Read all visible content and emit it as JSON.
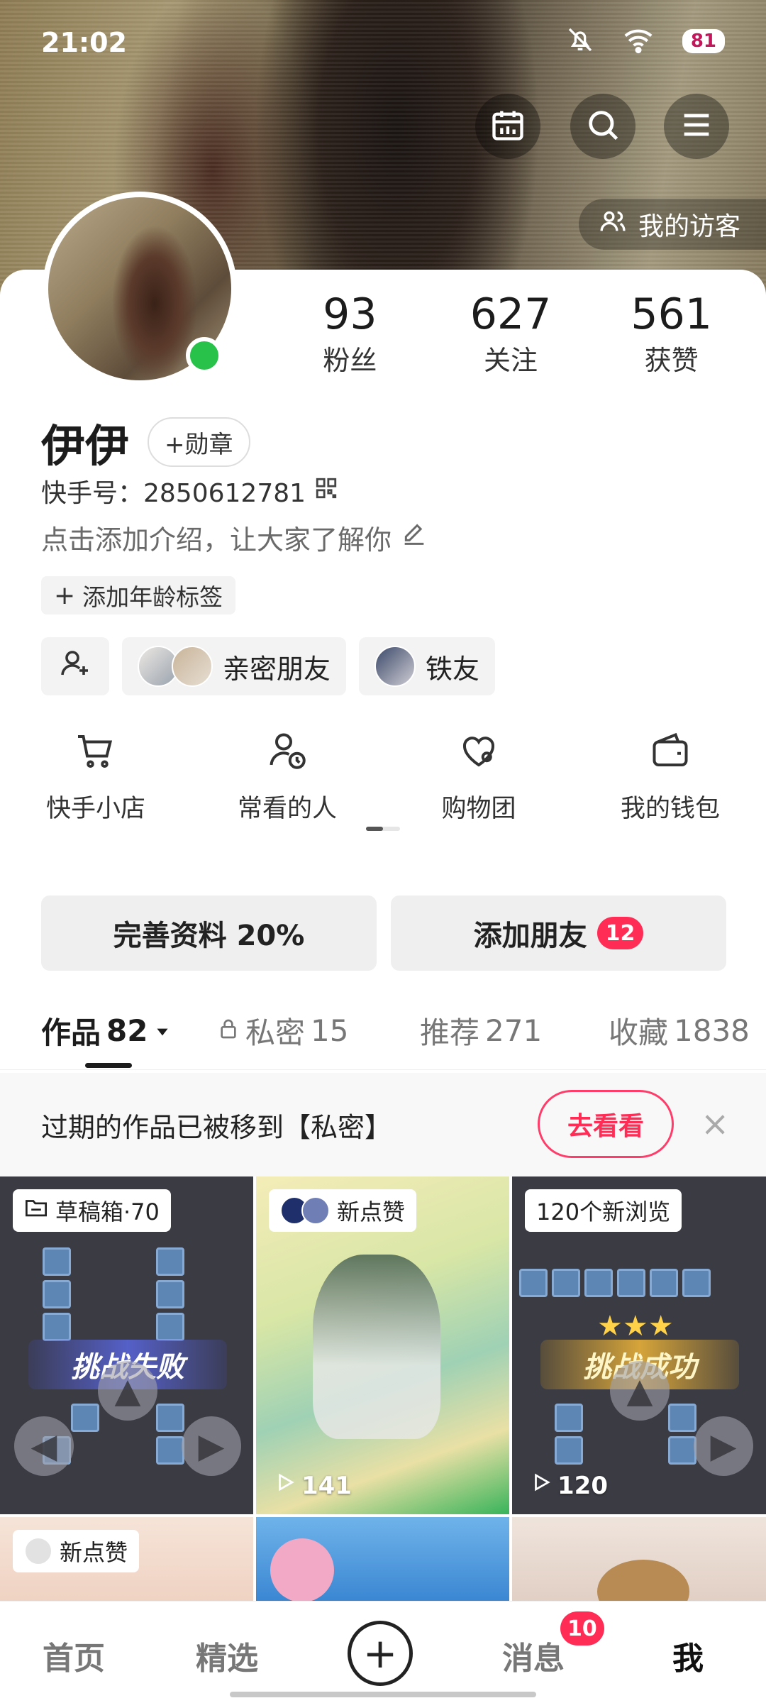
{
  "status_bar": {
    "time": "21:02",
    "battery": "81"
  },
  "header": {
    "visitors_label": "我的访客",
    "icons": [
      "calendar-icon",
      "search-icon",
      "menu-icon"
    ]
  },
  "profile": {
    "stats": [
      {
        "value": "93",
        "label": "粉丝"
      },
      {
        "value": "627",
        "label": "关注"
      },
      {
        "value": "561",
        "label": "获赞"
      }
    ],
    "name": "伊伊",
    "badge_button": "+勋章",
    "kuaishou_id": "快手号：2850612781",
    "intro": "点击添加介绍，让大家了解你",
    "age_tag": "添加年龄标签",
    "friend_chips": [
      {
        "label": "亲密朋友"
      },
      {
        "label": "铁友"
      }
    ]
  },
  "shortcuts": [
    {
      "label": "快手小店",
      "icon": "cart-icon"
    },
    {
      "label": "常看的人",
      "icon": "person-clock-icon"
    },
    {
      "label": "购物团",
      "icon": "heart-group-icon"
    },
    {
      "label": "我的钱包",
      "icon": "wallet-icon"
    }
  ],
  "actions": {
    "complete_profile": "完善资料 20%",
    "add_friends": "添加朋友",
    "add_friends_badge": "12"
  },
  "tabs": [
    {
      "label": "作品",
      "count": "82",
      "active": true
    },
    {
      "label": "私密",
      "count": "15"
    },
    {
      "label": "推荐",
      "count": "271"
    },
    {
      "label": "收藏",
      "count": "1838"
    }
  ],
  "notice": {
    "text": "过期的作品已被移到【私密】",
    "button": "去看看"
  },
  "grid": [
    {
      "label": "草稿箱·70",
      "banner": "挑战失败"
    },
    {
      "label": "新点赞",
      "plays": "141"
    },
    {
      "label": "120个新浏览",
      "plays": "120",
      "banner": "挑战成功"
    },
    {
      "label": "新点赞"
    }
  ],
  "bottom_nav": {
    "home": "首页",
    "featured": "精选",
    "messages": "消息",
    "messages_badge": "10",
    "me": "我"
  }
}
